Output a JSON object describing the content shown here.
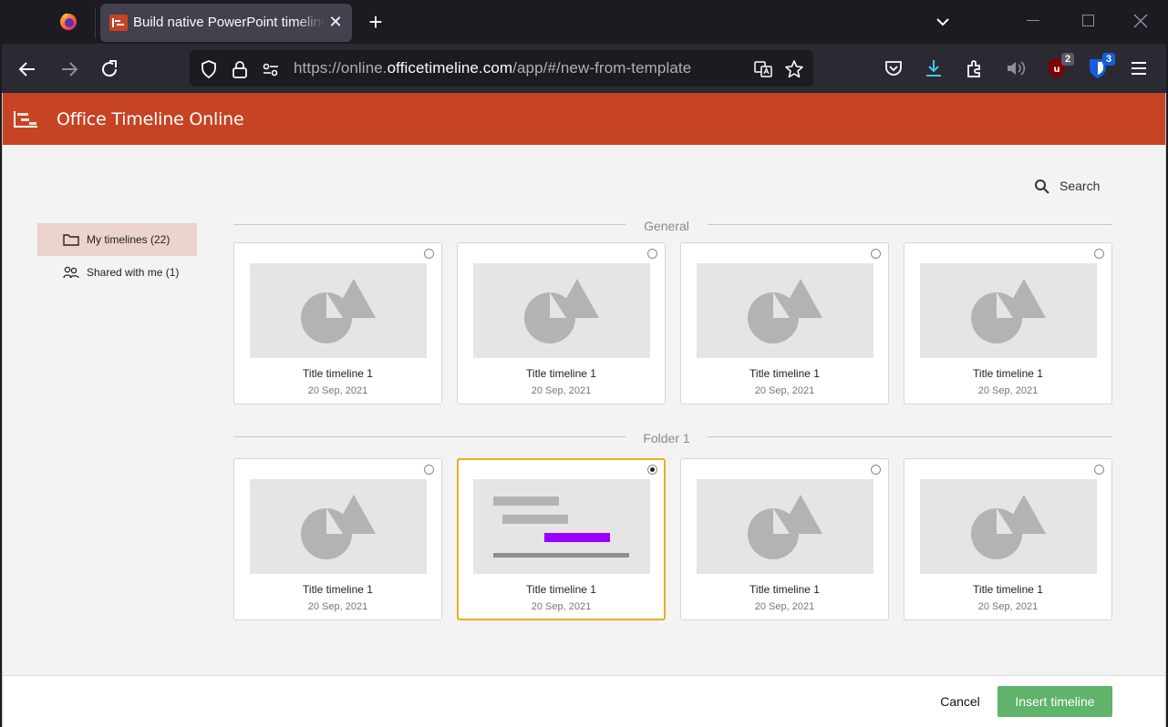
{
  "browser": {
    "tab_title": "Build native PowerPoint timeline",
    "url_prefix": "https://online.",
    "url_domain": "officetimeline.com",
    "url_path": "/app/#/new-from-template",
    "extension_badges": {
      "ublock": "2",
      "bitwarden": "3"
    }
  },
  "app": {
    "title": "Office Timeline Online",
    "accent_color": "#c64323"
  },
  "search": {
    "label": "Search"
  },
  "sidebar": {
    "items": [
      {
        "label": "My timelines (22)",
        "icon": "folder-icon",
        "active": true
      },
      {
        "label": "Shared with me (1)",
        "icon": "people-icon",
        "active": false
      }
    ]
  },
  "groups": [
    {
      "label": "General",
      "cards": [
        {
          "title": "Title timeline 1",
          "date": "20 Sep, 2021",
          "thumb": "placeholder",
          "selected": false
        },
        {
          "title": "Title timeline 1",
          "date": "20 Sep, 2021",
          "thumb": "placeholder",
          "selected": false
        },
        {
          "title": "Title timeline 1",
          "date": "20 Sep, 2021",
          "thumb": "placeholder",
          "selected": false
        },
        {
          "title": "Title timeline 1",
          "date": "20 Sep, 2021",
          "thumb": "placeholder",
          "selected": false
        }
      ]
    },
    {
      "label": "Folder 1",
      "cards": [
        {
          "title": "Title timeline 1",
          "date": "20 Sep, 2021",
          "thumb": "placeholder",
          "selected": false
        },
        {
          "title": "Title timeline 1",
          "date": "20 Sep, 2021",
          "thumb": "gantt",
          "selected": true
        },
        {
          "title": "Title timeline 1",
          "date": "20 Sep, 2021",
          "thumb": "placeholder",
          "selected": false
        },
        {
          "title": "Title timeline 1",
          "date": "20 Sep, 2021",
          "thumb": "placeholder",
          "selected": false
        }
      ]
    }
  ],
  "footer": {
    "cancel_label": "Cancel",
    "insert_label": "Insert timeline",
    "insert_color": "#5fb36b"
  }
}
